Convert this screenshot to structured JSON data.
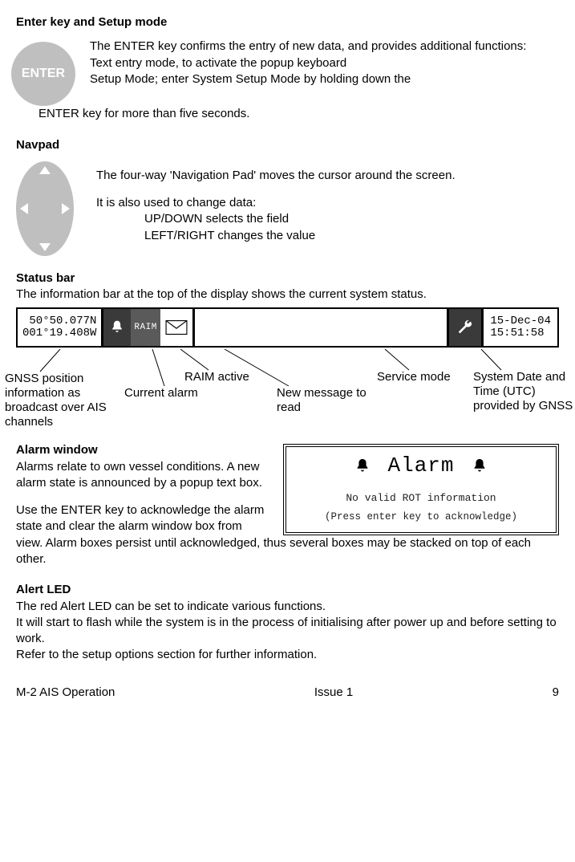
{
  "enter": {
    "heading": "Enter key and Setup mode",
    "button_label": "ENTER",
    "p1": "The ENTER key confirms the entry of new data, and provides additional functions:",
    "p2": "Text entry mode, to activate the popup keyboard",
    "p3": "Setup Mode; enter System Setup Mode by holding down the",
    "p4": "ENTER key for more than five seconds."
  },
  "navpad": {
    "heading": "Navpad",
    "p1": "The four-way 'Navigation Pad' moves the cursor around the screen.",
    "p2": "It is also used to change data:",
    "l1": "UP/DOWN selects the field",
    "l2": "LEFT/RIGHT changes the value"
  },
  "status": {
    "heading": "Status bar",
    "desc": "The information bar at the top of the display shows the current system status.",
    "coords": " 50°50.077N\n001°19.408W",
    "raim": "RAIM",
    "datetime": "15-Dec-04\n15:51:58",
    "labels": {
      "gnss": "GNSS position information as broadcast over AIS channels",
      "alarm": "Current alarm",
      "raim_active": "RAIM active",
      "new_msg": "New message to read",
      "service": "Service mode",
      "sysdate": "System Date and Time (UTC) provided by GNSS"
    }
  },
  "alarm": {
    "heading": "Alarm window",
    "p1": "Alarms relate to own vessel conditions. A new alarm state is announced by a popup text box.",
    "p2a": "Use the ENTER key to acknowledge the alarm state and clear the alarm window box from",
    "p2b": "view. Alarm boxes persist until acknowledged, thus several boxes may be stacked on top of each other.",
    "box_title": "Alarm",
    "box_msg": "No valid ROT information",
    "box_ack": "(Press enter key to acknowledge)"
  },
  "alert": {
    "heading": "Alert LED",
    "p1": "The red Alert LED can be set to indicate various functions.",
    "p2": "It will start to flash while the system is in the process of initialising after power up and before setting to work.",
    "p3": "Refer to the setup options section for further information."
  },
  "footer": {
    "left": "M-2 AIS Operation",
    "center": "Issue 1",
    "right": "9"
  }
}
